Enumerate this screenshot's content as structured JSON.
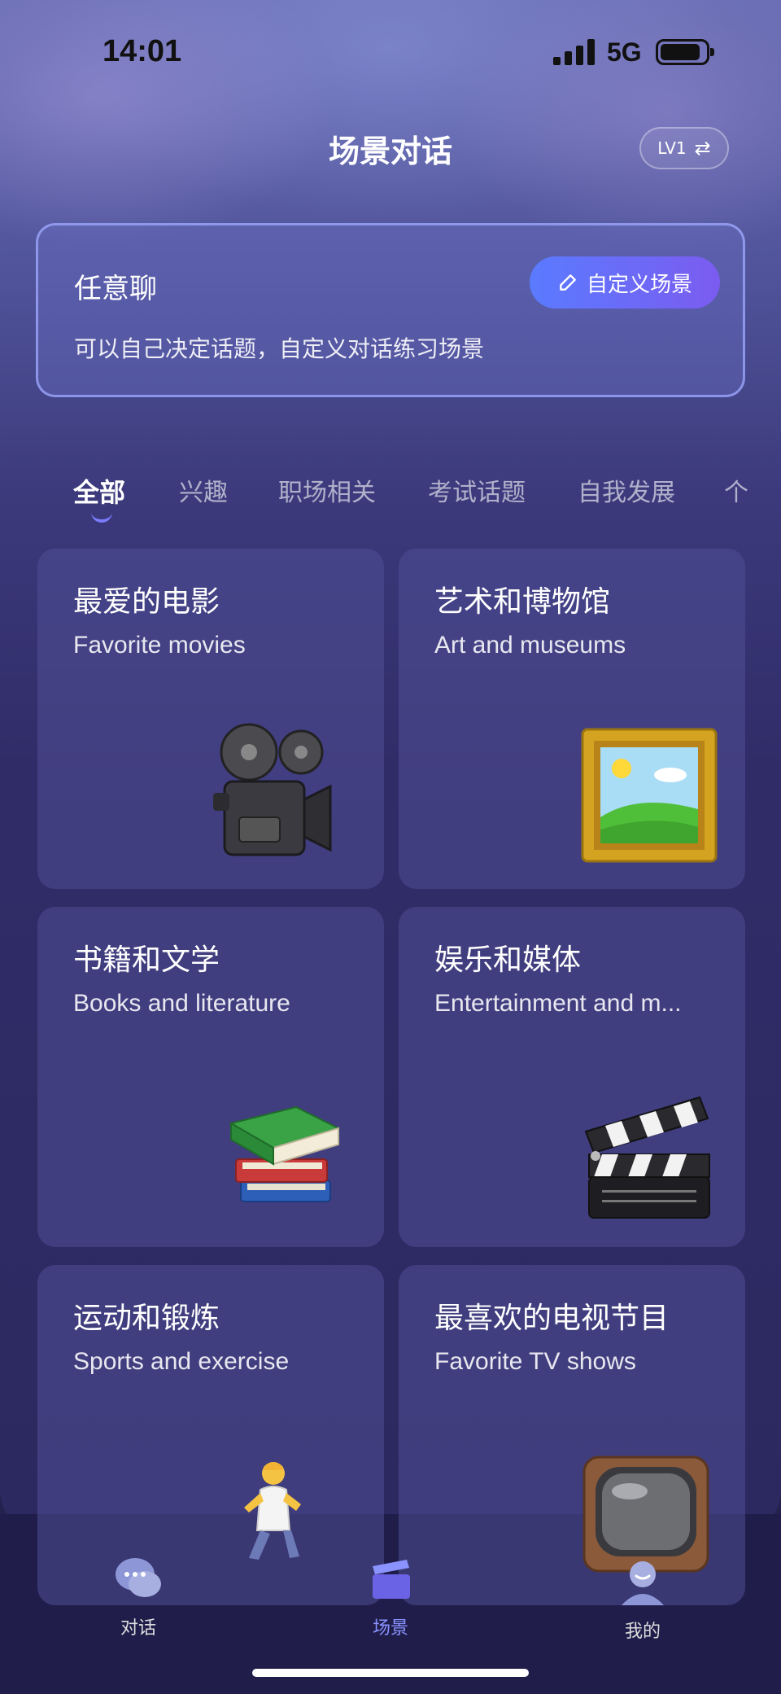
{
  "status_bar": {
    "time": "14:01",
    "network": "5G"
  },
  "header": {
    "title": "场景对话",
    "level": "LV1",
    "swap_icon": "swap-arrows-icon"
  },
  "custom_card": {
    "title": "任意聊",
    "description": "可以自己决定话题，自定义对话练习场景",
    "button_label": "自定义场景"
  },
  "tabs": [
    {
      "label": "全部",
      "active": true
    },
    {
      "label": "兴趣"
    },
    {
      "label": "职场相关"
    },
    {
      "label": "考试话题"
    },
    {
      "label": "自我发展"
    },
    {
      "label": "个"
    }
  ],
  "scenes": [
    {
      "title": "最爱的电影",
      "subtitle": "Favorite movies",
      "icon": "movie-camera-icon"
    },
    {
      "title": "艺术和博物馆",
      "subtitle": "Art and museums",
      "icon": "framed-picture-icon"
    },
    {
      "title": "书籍和文学",
      "subtitle": "Books and literature",
      "icon": "books-icon"
    },
    {
      "title": "娱乐和媒体",
      "subtitle": "Entertainment and m...",
      "icon": "clapper-board-icon"
    },
    {
      "title": "运动和锻炼",
      "subtitle": "Sports and exercise",
      "icon": "running-person-icon"
    },
    {
      "title": "最喜欢的电视节目",
      "subtitle": "Favorite TV shows",
      "icon": "television-icon"
    }
  ],
  "tab_bar": [
    {
      "label": "对话",
      "icon": "chat-bubbles-icon"
    },
    {
      "label": "场景",
      "icon": "clapper-icon",
      "active": true
    },
    {
      "label": "我的",
      "icon": "profile-icon"
    }
  ],
  "colors": {
    "accent": "#7b7cff",
    "button_start": "#5a7bff",
    "button_end": "#7b5cf0"
  }
}
